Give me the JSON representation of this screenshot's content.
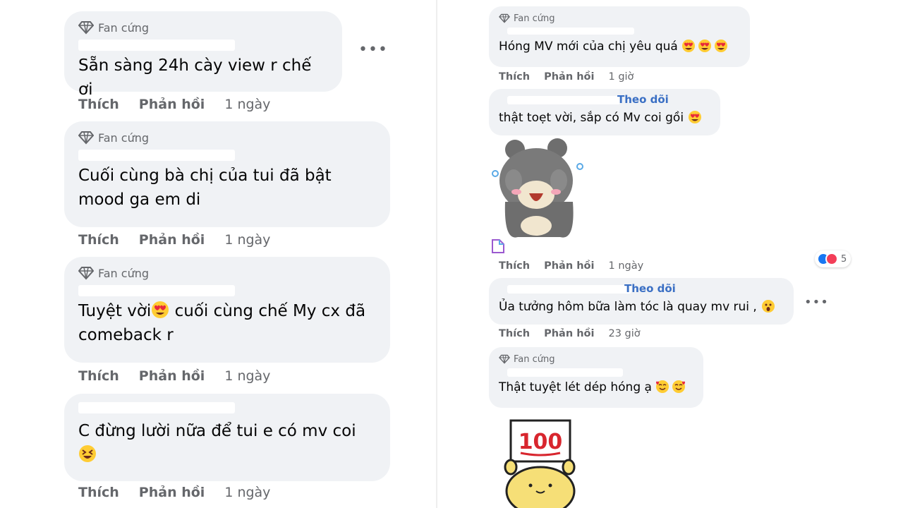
{
  "left": {
    "comments": [
      {
        "badge": "Fan cứng",
        "text": "Sẵn sàng 24h cày view r chế ơi",
        "actions": {
          "like": "Thích",
          "reply": "Phản hồi",
          "time": "1 ngày"
        }
      },
      {
        "badge": "Fan cứng",
        "text_line1": "Cuối cùng bà chị của tui đã bật",
        "text_line2": "mood ga em di",
        "actions": {
          "like": "Thích",
          "reply": "Phản hồi",
          "time": "1 ngày"
        }
      },
      {
        "badge": "Fan cứng",
        "text_line1_a": "Tuyệt vời",
        "text_line1_b": " cuối cùng chế My cx đã",
        "text_line2": "comeback r",
        "actions": {
          "like": "Thích",
          "reply": "Phản hồi",
          "time": "1 ngày"
        }
      },
      {
        "text": "C đừng lười nữa để tui e có mv coi",
        "actions": {
          "like": "Thích",
          "reply": "Phản hồi",
          "time": "1 ngày"
        }
      }
    ]
  },
  "right": {
    "comments": [
      {
        "badge": "Fan cứng",
        "text": "Hóng MV mới của chị yêu quá",
        "actions": {
          "like": "Thích",
          "reply": "Phản hồi",
          "time": "1 giờ"
        }
      },
      {
        "follow": "Theo dõi",
        "text": "thật toẹt vời, sắp có Mv coi gồi",
        "actions": {
          "like": "Thích",
          "reply": "Phản hồi",
          "time": "1 ngày"
        },
        "reactions_count": "5"
      },
      {
        "follow": "Theo dõi",
        "text": "Ủa tưởng hôm bữa làm tóc là quay mv rui ,",
        "actions": {
          "like": "Thích",
          "reply": "Phản hồi",
          "time": "23 giờ"
        }
      },
      {
        "badge": "Fan cứng",
        "text": "Thật tuyệt lét dép hóng ạ"
      }
    ],
    "sticker_text": "100"
  },
  "colors": {
    "bubble": "#f0f2f5",
    "secondary_text": "#65676b",
    "follow_link": "#3a6fc4",
    "like_reaction": "#1877f2",
    "love_reaction": "#f33e58"
  }
}
